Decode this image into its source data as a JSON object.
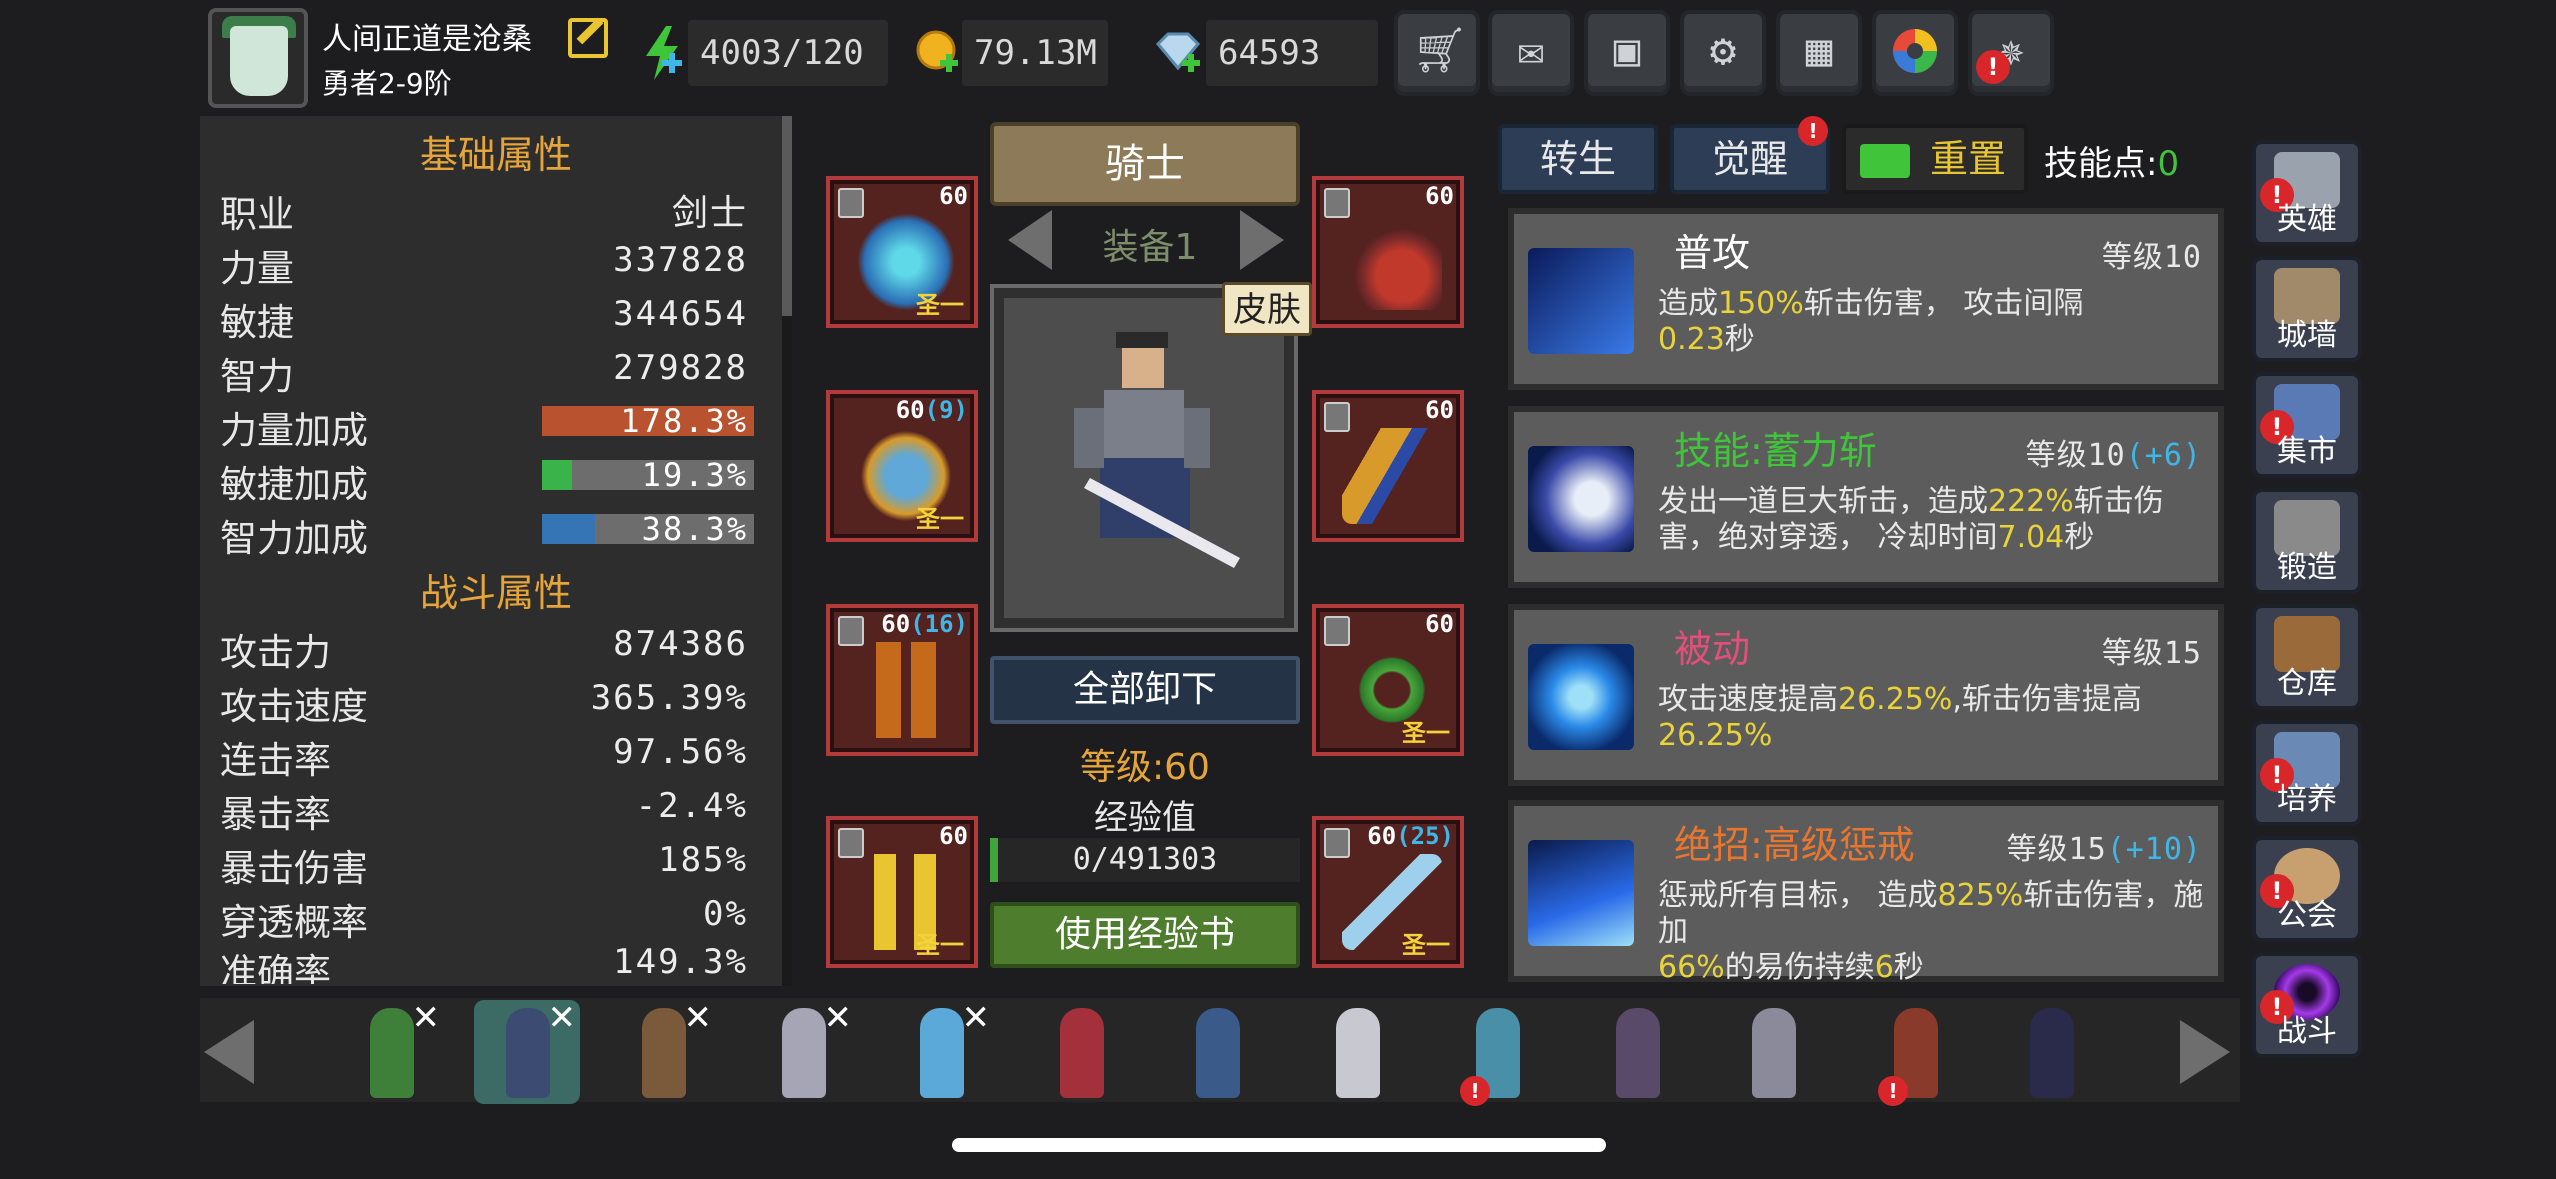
{
  "player": {
    "name": "人间正道是沧桑",
    "rank": "勇者2-9阶"
  },
  "resources": {
    "energy": "4003/120",
    "gold": "79.13M",
    "gems": "64593"
  },
  "toolbar": [
    "shop-icon",
    "mail-icon",
    "gamepad-icon",
    "gear-icon",
    "gift-icon",
    "color-wheel-icon",
    "fireworks-icon"
  ],
  "stats": {
    "basic_title": "基础属性",
    "basic": [
      {
        "name": "职业",
        "value": "剑士"
      },
      {
        "name": "力量",
        "value": "337828"
      },
      {
        "name": "敏捷",
        "value": "344654"
      },
      {
        "name": "智力",
        "value": "279828"
      }
    ],
    "bonus": [
      {
        "name": "力量加成",
        "value": "178.3%",
        "pct": 1.0,
        "color": "#b9532f"
      },
      {
        "name": "敏捷加成",
        "value": "19.3%",
        "pct": 0.14,
        "color": "#39b34a"
      },
      {
        "name": "智力加成",
        "value": "38.3%",
        "pct": 0.25,
        "color": "#3574b5"
      }
    ],
    "combat_title": "战斗属性",
    "combat": [
      {
        "name": "攻击力",
        "value": "874386"
      },
      {
        "name": "攻击速度",
        "value": "365.39%"
      },
      {
        "name": "连击率",
        "value": "97.56%"
      },
      {
        "name": "暴击率",
        "value": "-2.4%"
      },
      {
        "name": "暴击伤害",
        "value": "185%"
      },
      {
        "name": "穿透概率",
        "value": "0%"
      },
      {
        "name": "准确率",
        "value": "149.3%"
      }
    ]
  },
  "equipment": {
    "class_banner": "骑士",
    "set_label": "装备1",
    "skin_label": "皮肤",
    "slots": [
      {
        "level": "60",
        "extra": "",
        "tag": "圣一"
      },
      {
        "level": "60",
        "extra": "",
        "tag": ""
      },
      {
        "level": "60",
        "extra": "(9)",
        "tag": "圣一"
      },
      {
        "level": "60",
        "extra": "",
        "tag": ""
      },
      {
        "level": "60",
        "extra": "(16)",
        "tag": ""
      },
      {
        "level": "60",
        "extra": "",
        "tag": "圣一"
      },
      {
        "level": "60",
        "extra": "",
        "tag": "圣一"
      },
      {
        "level": "60",
        "extra": "(25)",
        "tag": "圣一"
      }
    ],
    "unequip_all": "全部卸下",
    "level_text": "等级:60",
    "exp_label": "经验值",
    "exp_value": "0/491303",
    "exp_progress": 0,
    "use_exp_book": "使用经验书"
  },
  "skills": {
    "tabs": [
      "转生",
      "觉醒"
    ],
    "reset_label": "重置",
    "points_label": "技能点:",
    "points_value": "0",
    "cards": [
      {
        "name": "普攻",
        "name_color": "#ffffff",
        "level": "等级10",
        "plus": "",
        "desc": [
          "造成",
          "150%",
          "斩击伤害， 攻击间隔",
          "0.23",
          "秒"
        ]
      },
      {
        "name": "技能:蓄力斩",
        "name_color": "#3fc43a",
        "level": "等级10",
        "plus": "(+6)",
        "desc": [
          "发出一道巨大斩击，造成",
          "222%",
          "斩击伤害，绝对穿透， 冷却时间",
          "7.04",
          "秒"
        ]
      },
      {
        "name": "被动",
        "name_color": "#e2507a",
        "level": "等级15",
        "plus": "",
        "desc": [
          "攻击速度提高",
          "26.25%",
          ",斩击伤害提高",
          "26.25%",
          ""
        ]
      },
      {
        "name": "绝招:高级惩戒",
        "name_color": "#e8762f",
        "level": "等级15",
        "plus": "(+10)",
        "desc": [
          "惩戒所有目标， 造成",
          "825%",
          "斩击伤害，施加",
          "66%",
          "的易伤持续",
          "6",
          "秒"
        ]
      }
    ]
  },
  "nav": [
    {
      "label": "英雄",
      "badge": "!"
    },
    {
      "label": "城墙",
      "badge": ""
    },
    {
      "label": "集市",
      "badge": "!"
    },
    {
      "label": "锻造",
      "badge": ""
    },
    {
      "label": "仓库",
      "badge": ""
    },
    {
      "label": "培养",
      "badge": "!"
    },
    {
      "label": "公会",
      "badge": "!"
    },
    {
      "label": "战斗",
      "badge": "!"
    }
  ],
  "heroes": [
    {
      "color": "#3e7f3a",
      "x": "✕",
      "badge": ""
    },
    {
      "color": "#3b4b72",
      "x": "✕",
      "badge": ""
    },
    {
      "color": "#7a5a3a",
      "x": "✕",
      "badge": ""
    },
    {
      "color": "#a5a5b5",
      "x": "✕",
      "badge": ""
    },
    {
      "color": "#5aa9d8",
      "x": "✕",
      "badge": ""
    },
    {
      "color": "#a3303a",
      "x": "",
      "badge": ""
    },
    {
      "color": "#3a5a8a",
      "x": "",
      "badge": ""
    },
    {
      "color": "#c8c8d0",
      "x": "",
      "badge": ""
    },
    {
      "color": "#4a8fa8",
      "x": "",
      "badge": "!"
    },
    {
      "color": "#5a4a6a",
      "x": "",
      "badge": ""
    },
    {
      "color": "#8a8a9a",
      "x": "",
      "badge": ""
    },
    {
      "color": "#8a3a2a",
      "x": "",
      "badge": "!"
    },
    {
      "color": "#2a2a4a",
      "x": "",
      "badge": ""
    }
  ],
  "badges": {
    "awaken": "!",
    "settings": "!"
  }
}
